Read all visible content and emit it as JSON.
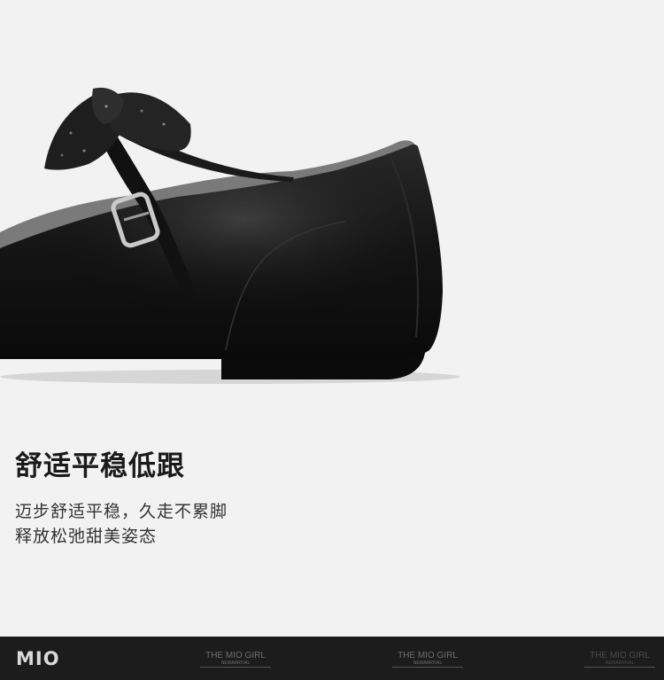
{
  "product_image": {
    "subject": "black leather mary jane shoe with glitter bow (heel view)",
    "colors": {
      "background": "#f2f2f2",
      "leather": "#121212",
      "sole": "#0b0b0b",
      "buckle": "#c9c9c9"
    }
  },
  "headline": "舒适平稳低跟",
  "description": {
    "line1": "迈步舒适平稳，久走不累脚",
    "line2": "释放松弛甜美姿态"
  },
  "footer": {
    "logo": "MIO",
    "tags": [
      {
        "title": "THE MIO GIRL",
        "subtitle": "NEWARRIVAL"
      },
      {
        "title": "THE MIO GIRL",
        "subtitle": "NEWARRIVAL"
      },
      {
        "title": "THE MIO GIRL",
        "subtitle": "NEWARRIVAL"
      }
    ],
    "background": "#1c1c1c"
  }
}
